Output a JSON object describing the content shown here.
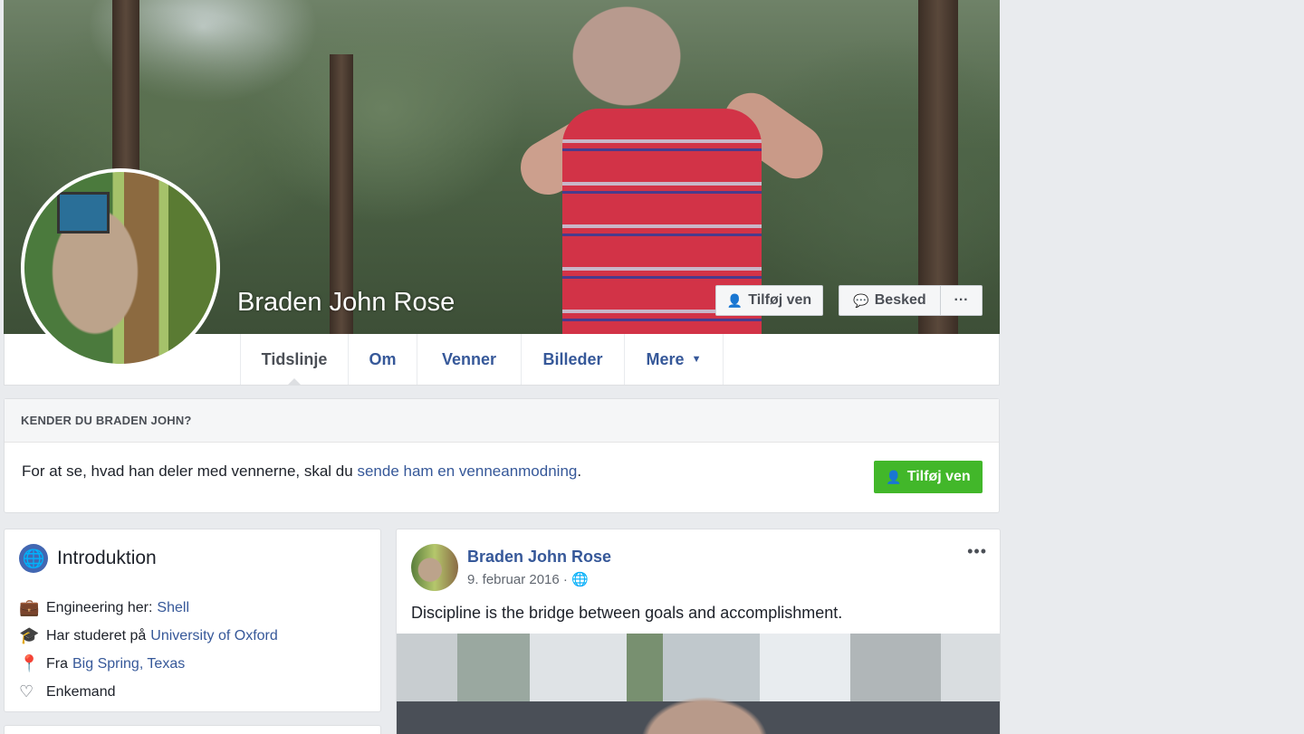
{
  "profile": {
    "name": "Braden John Rose",
    "add_friend_label": "Tilføj ven",
    "message_label": "Besked",
    "more_label": "···"
  },
  "nav": {
    "tabs": [
      {
        "label": "Tidslinje"
      },
      {
        "label": "Om"
      },
      {
        "label": "Venner"
      },
      {
        "label": "Billeder"
      },
      {
        "label": "Mere"
      }
    ]
  },
  "know_card": {
    "heading": "KENDER DU BRADEN JOHN?",
    "text_prefix": "For at se, hvad han deler med vennerne, skal du ",
    "link_text": "sende ham en venneanmodning",
    "text_suffix": ".",
    "button_label": "Tilføj ven"
  },
  "intro": {
    "title": "Introduktion",
    "items": [
      {
        "icon": "briefcase-icon",
        "prefix": "Engineering her:",
        "link": "Shell"
      },
      {
        "icon": "graduation-cap-icon",
        "prefix": "Har studeret på",
        "link": "University of Oxford"
      },
      {
        "icon": "location-pin-icon",
        "prefix": "Fra",
        "link": "Big Spring, Texas"
      },
      {
        "icon": "heart-icon",
        "prefix": "Enkemand",
        "link": ""
      }
    ]
  },
  "post": {
    "author": "Braden John Rose",
    "date": "9. februar 2016 ·",
    "text": "Discipline is the bridge between goals and accomplishment.",
    "more_label": "•••"
  },
  "colors": {
    "link": "#365899",
    "green": "#42b72a",
    "background": "#e9ebee"
  }
}
